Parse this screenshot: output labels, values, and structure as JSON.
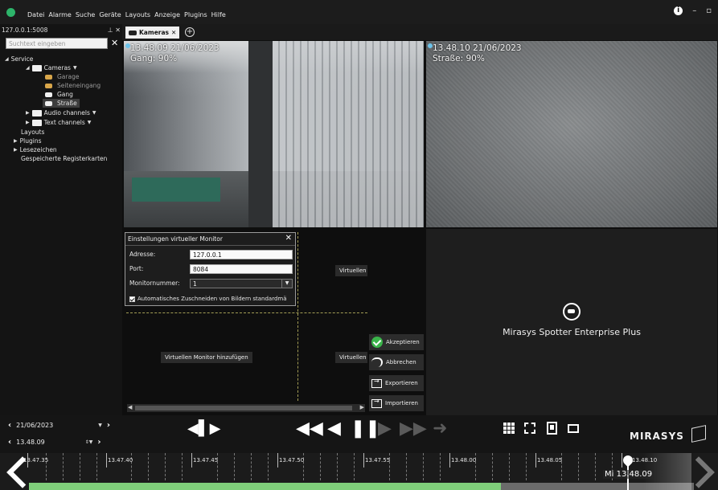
{
  "menu": {
    "items": [
      "Datei",
      "Alarme",
      "Suche",
      "Geräte",
      "Layouts",
      "Anzeige",
      "Plugins",
      "Hilfe"
    ],
    "win_minimize": "–",
    "win_maximize": "▫"
  },
  "sidebar": {
    "server": "127.0.0.1:5008",
    "search_placeholder": "Suchtext eingeben",
    "tree": {
      "service": "Service",
      "cameras": "Cameras",
      "camera_items": [
        "Garage",
        "Seiteneingang",
        "Gang",
        "Straße"
      ],
      "audio": "Audio channels",
      "text": "Text channels",
      "layouts": "Layouts",
      "plugins": "Plugins",
      "bookmarks": "Lesezeichen",
      "saved_tabs": "Gespeicherte Registerkarten"
    }
  },
  "tabs": {
    "active": "Kameras"
  },
  "cameras": [
    {
      "time": "13.48.09  21/06/2023",
      "label": "Gang: 90%"
    },
    {
      "time": "13.48.10  21/06/2023",
      "label": "Straße: 90%"
    }
  ],
  "brand": {
    "product": "Mirasys Spotter Enterprise Plus",
    "logo": "MIRASYS"
  },
  "dialog": {
    "title": "Einstellungen virtueller Monitor",
    "address_label": "Adresse:",
    "address_value": "127.0.0.1",
    "port_label": "Port:",
    "port_value": "8084",
    "monitor_label": "Monitornummer:",
    "monitor_value": "1",
    "auto_crop": "Automatisches Zuschneiden von Bildern standardmä"
  },
  "virtual": {
    "vm1": "Virtuellen",
    "vm2": "Virtuellen",
    "add": "Virtuellen Monitor hinzufügen"
  },
  "actions": {
    "accept": "Akzeptieren",
    "cancel": "Abbrechen",
    "export": "Exportieren",
    "import": "Importieren"
  },
  "playback": {
    "date": "21/06/2023",
    "time": "13.48.09"
  },
  "timeline": {
    "labels": [
      "13.47.35",
      "13.47.40",
      "13.47.45",
      "13.47.50",
      "13.47.55",
      "13.48.00",
      "13.48.05",
      "13.48.10"
    ],
    "cursor": "Mi 13.48.09"
  },
  "colors": {
    "recording": "#7fcf7a",
    "accent_accept": "#3ab44a",
    "osd_dot": "#6cc3ea"
  }
}
